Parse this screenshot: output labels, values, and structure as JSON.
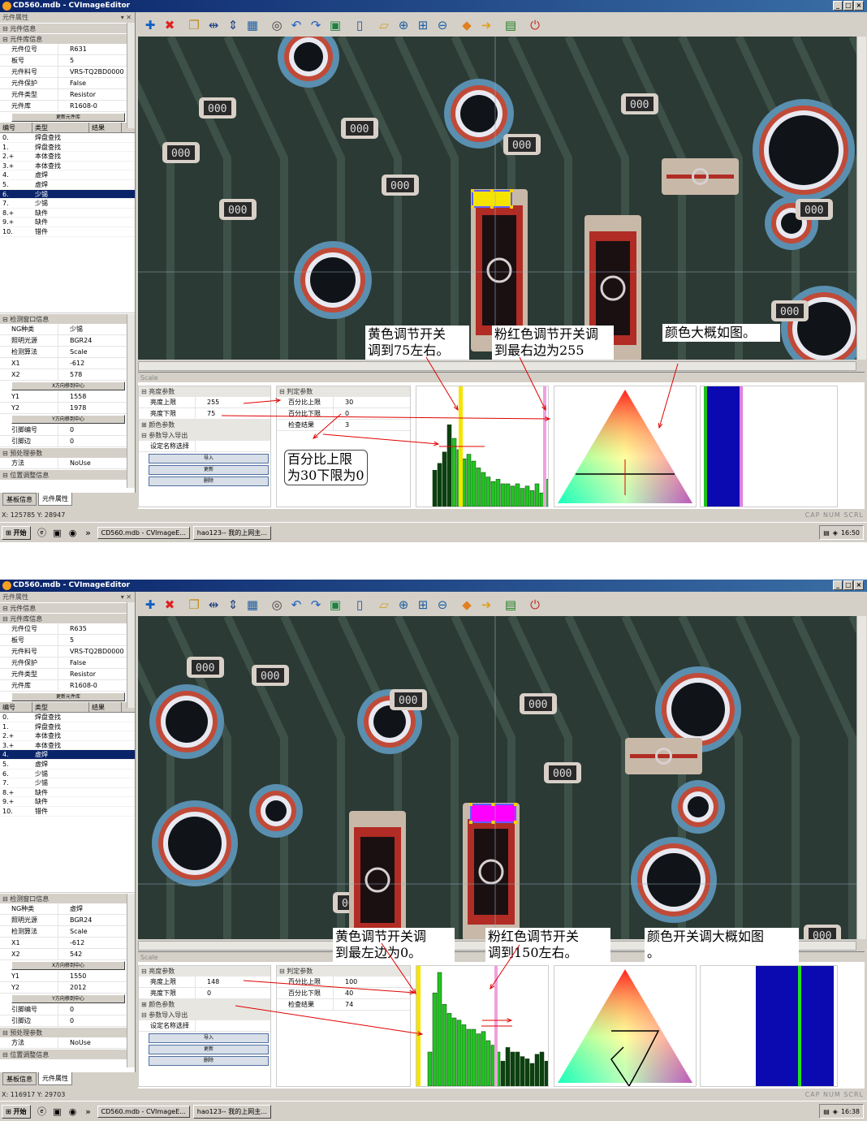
{
  "screens": [
    {
      "title": "CD560.mdb - CVImageEditor",
      "panel_header": "元件属性",
      "component_info": {
        "section": "元件信息",
        "lib_section": "元件库信息",
        "rows": [
          {
            "k": "元件位号",
            "v": "R631"
          },
          {
            "k": "板号",
            "v": "5"
          },
          {
            "k": "元件料号",
            "v": "VRS-TQ2BD0000"
          },
          {
            "k": "元件保护",
            "v": "False"
          },
          {
            "k": "元件类型",
            "v": "Resistor"
          },
          {
            "k": "元件库",
            "v": "R1608-0"
          }
        ],
        "update_button": "更新元件库"
      },
      "table": {
        "headers": [
          "编号",
          "类型",
          "结果"
        ],
        "rows": [
          {
            "id": "0.",
            "type": "焊盘查找"
          },
          {
            "id": "1.",
            "type": "焊盘查找"
          },
          {
            "id": "2.+",
            "type": "本体查找"
          },
          {
            "id": "3.+",
            "type": "本体查找"
          },
          {
            "id": "4.",
            "type": "虚焊"
          },
          {
            "id": "5.",
            "type": "虚焊"
          },
          {
            "id": "6.",
            "type": "少锡"
          },
          {
            "id": "7.",
            "type": "少锡"
          },
          {
            "id": "8.+",
            "type": "缺件"
          },
          {
            "id": "9.+",
            "type": "缺件"
          },
          {
            "id": "10.",
            "type": "错件"
          }
        ],
        "selected_index": 6
      },
      "detect_window": {
        "section": "检测窗口信息",
        "rows_a": [
          {
            "k": "NG种类",
            "v": "少锡"
          },
          {
            "k": "照明光源",
            "v": "BGR24"
          },
          {
            "k": "检测算法",
            "v": "Scale"
          },
          {
            "k": "X1",
            "v": "-612"
          },
          {
            "k": "X2",
            "v": "578"
          }
        ],
        "x_mirror": "X方向移到中心",
        "rows_b": [
          {
            "k": "Y1",
            "v": "1558"
          },
          {
            "k": "Y2",
            "v": "1978"
          }
        ],
        "y_mirror": "Y方向移到中心",
        "rows_c": [
          {
            "k": "引脚编号",
            "v": "0"
          },
          {
            "k": "引脚边",
            "v": "0"
          }
        ],
        "preprocess_section": "预处理参数",
        "method": {
          "k": "方法",
          "v": "NoUse"
        },
        "pos_section": "位置调整信息"
      },
      "tabs": [
        "基板信息",
        "元件属性"
      ],
      "scale_label": "Scale",
      "brightness": {
        "section": "亮度参数",
        "upper": {
          "k": "亮度上限",
          "v": "255"
        },
        "lower": {
          "k": "亮度下限",
          "v": "75"
        },
        "color_section": "颜色参数",
        "io_section": "参数导入导出",
        "name_select": "设定名称选择",
        "buttons": [
          "导入",
          "更新",
          "删除"
        ]
      },
      "judge": {
        "section": "判定参数",
        "rows": [
          {
            "k": "百分比上限",
            "v": "30"
          },
          {
            "k": "百分比下限",
            "v": "0"
          },
          {
            "k": "检查结果",
            "v": "3"
          }
        ]
      },
      "histogram": {
        "bars_hi": [
          0.32,
          0.38,
          0.48,
          0.72,
          0.6,
          0.5,
          0.42,
          0.46,
          0.4,
          0.34,
          0.3,
          0.26,
          0.22,
          0.24,
          0.2,
          0.2,
          0.18,
          0.2,
          0.16,
          0.18,
          0.14,
          0.2,
          0.12,
          0.24,
          0.16
        ],
        "threshold_marker": "yellow",
        "pink_marker": "pink"
      },
      "callouts": [
        {
          "text": "黄色调节开关\n调到75左右。"
        },
        {
          "text": "粉红色调节开关调\n到最右边为255"
        },
        {
          "text": "颜色大概如图。"
        }
      ],
      "bubble": "百分比上限\n为30下限为0",
      "status_coords": "X: 125785 Y: 28947",
      "status_flags": "CAP  NUM  SCRL",
      "taskbar": {
        "start": "开始",
        "tasks": [
          "CD560.mdb - CVImageE...",
          "hao123-- 我的上网主..."
        ],
        "clock": "16:50"
      }
    },
    {
      "title": "CD560.mdb - CVImageEditor",
      "panel_header": "元件属性",
      "component_info": {
        "section": "元件信息",
        "lib_section": "元件库信息",
        "rows": [
          {
            "k": "元件位号",
            "v": "R635"
          },
          {
            "k": "板号",
            "v": "5"
          },
          {
            "k": "元件料号",
            "v": "VRS-TQ2BD0000"
          },
          {
            "k": "元件保护",
            "v": "False"
          },
          {
            "k": "元件类型",
            "v": "Resistor"
          },
          {
            "k": "元件库",
            "v": "R1608-0"
          }
        ],
        "update_button": "更新元件库"
      },
      "table": {
        "headers": [
          "编号",
          "类型",
          "结果"
        ],
        "rows": [
          {
            "id": "0.",
            "type": "焊盘查找"
          },
          {
            "id": "1.",
            "type": "焊盘查找"
          },
          {
            "id": "2.+",
            "type": "本体查找"
          },
          {
            "id": "3.+",
            "type": "本体查找"
          },
          {
            "id": "4.",
            "type": "虚焊"
          },
          {
            "id": "5.",
            "type": "虚焊"
          },
          {
            "id": "6.",
            "type": "少锡"
          },
          {
            "id": "7.",
            "type": "少锡"
          },
          {
            "id": "8.+",
            "type": "缺件"
          },
          {
            "id": "9.+",
            "type": "缺件"
          },
          {
            "id": "10.",
            "type": "错件"
          }
        ],
        "selected_index": 4
      },
      "detect_window": {
        "section": "检测窗口信息",
        "rows_a": [
          {
            "k": "NG种类",
            "v": "虚焊"
          },
          {
            "k": "照明光源",
            "v": "BGR24"
          },
          {
            "k": "检测算法",
            "v": "Scale"
          },
          {
            "k": "X1",
            "v": "-612"
          },
          {
            "k": "X2",
            "v": "542"
          }
        ],
        "x_mirror": "X方向移到中心",
        "rows_b": [
          {
            "k": "Y1",
            "v": "1550"
          },
          {
            "k": "Y2",
            "v": "2012"
          }
        ],
        "y_mirror": "Y方向移到中心",
        "rows_c": [
          {
            "k": "引脚编号",
            "v": "0"
          },
          {
            "k": "引脚边",
            "v": "0"
          }
        ],
        "preprocess_section": "预处理参数",
        "method": {
          "k": "方法",
          "v": "NoUse"
        },
        "pos_section": "位置调整信息"
      },
      "tabs": [
        "基板信息",
        "元件属性"
      ],
      "scale_label": "Scale",
      "brightness": {
        "section": "亮度参数",
        "upper": {
          "k": "亮度上限",
          "v": "148"
        },
        "lower": {
          "k": "亮度下限",
          "v": "0"
        },
        "color_section": "颜色参数",
        "io_section": "参数导入导出",
        "name_select": "设定名称选择",
        "buttons": [
          "导入",
          "更新",
          "删除"
        ]
      },
      "judge": {
        "section": "判定参数",
        "rows": [
          {
            "k": "百分比上限",
            "v": "100"
          },
          {
            "k": "百分比下限",
            "v": "40"
          },
          {
            "k": "检查结果",
            "v": "74"
          }
        ]
      },
      "histogram": {
        "bars_hi": [
          0.3,
          0.82,
          1.0,
          0.72,
          0.64,
          0.6,
          0.58,
          0.54,
          0.5,
          0.5,
          0.46,
          0.48,
          0.4,
          0.36,
          0.3,
          0.22,
          0.34,
          0.3,
          0.3,
          0.26,
          0.24,
          0.2,
          0.28,
          0.3,
          0.22
        ],
        "threshold_marker": "yellow",
        "pink_marker": "pink"
      },
      "callouts": [
        {
          "text": "黄色调节开关调\n到最左边为0。"
        },
        {
          "text": "粉红色调节开关\n调到150左右。"
        },
        {
          "text": "颜色开关调大概如图\n。"
        }
      ],
      "bubble": "",
      "status_coords": "X: 116917 Y: 29703",
      "status_flags": "CAP  NUM  SCRL",
      "taskbar": {
        "start": "开始",
        "tasks": [
          "CD560.mdb - CVImageE...",
          "hao123-- 我的上网主..."
        ],
        "clock": "16:38"
      }
    }
  ],
  "toolbar_icons": [
    "add-icon",
    "delete-icon",
    "copy-icon",
    "align-h-icon",
    "align-v-icon",
    "select-icon",
    "inspect-icon",
    "undo-icon",
    "redo-icon",
    "layer-icon",
    "save-icon",
    "open-icon",
    "zoom-in-icon",
    "zoom-fit-icon",
    "zoom-out-icon",
    "prev-icon",
    "next-icon",
    "export-icon",
    "power-icon"
  ],
  "colors": {
    "title_bar": "#0a246a",
    "selection": "#0a246a",
    "highlight_box_1": "#f5e400",
    "highlight_box_2": "#ff00ff",
    "histogram_bar": "#22c422",
    "annotation_arrow": "#e00000"
  }
}
